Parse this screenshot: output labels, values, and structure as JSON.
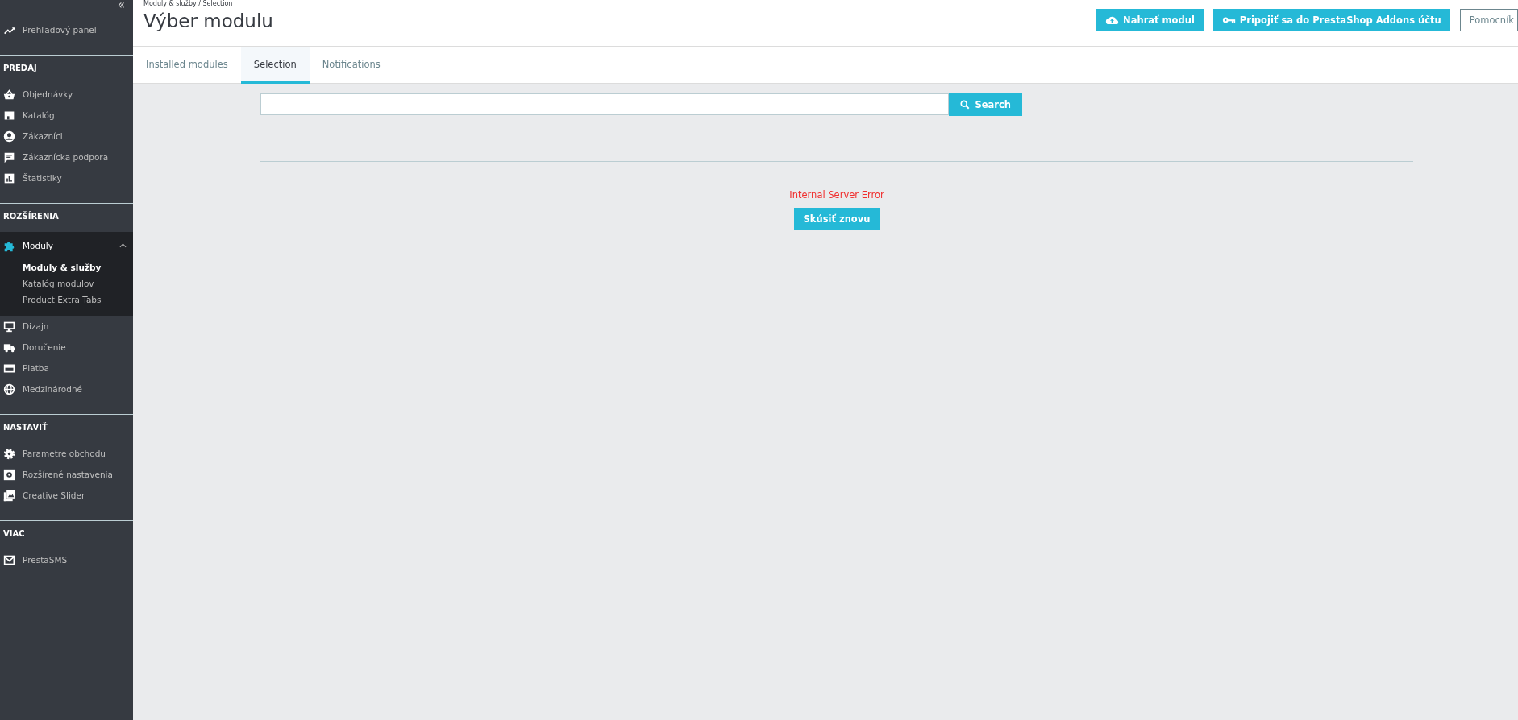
{
  "sidebar": {
    "collapse_label": "«",
    "sections": [
      {
        "items": [
          {
            "label": "Prehľadový panel",
            "selected": false,
            "expanded": false
          }
        ]
      },
      {
        "title": "PREDAJ",
        "items": [
          {
            "label": "Objednávky",
            "selected": false,
            "expanded": false
          },
          {
            "label": "Katalóg",
            "selected": false,
            "expanded": false
          },
          {
            "label": "Zákazníci",
            "selected": false,
            "expanded": false
          },
          {
            "label": "Zákaznícka podpora",
            "selected": false,
            "expanded": false
          },
          {
            "label": "Štatistiky",
            "selected": false,
            "expanded": false
          }
        ]
      },
      {
        "title": "ROZŠÍRENIA",
        "items": [
          {
            "label": "Moduly",
            "selected": true,
            "expanded": true,
            "children": [
              {
                "label": "Moduly & služby",
                "selected": true
              },
              {
                "label": "Katalóg modulov",
                "selected": false
              },
              {
                "label": "Product Extra Tabs",
                "selected": false
              }
            ]
          },
          {
            "label": "Dizajn",
            "selected": false,
            "expanded": false
          },
          {
            "label": "Doručenie",
            "selected": false,
            "expanded": false
          },
          {
            "label": "Platba",
            "selected": false,
            "expanded": false
          },
          {
            "label": "Medzinárodné",
            "selected": false,
            "expanded": false
          }
        ]
      },
      {
        "title": "NASTAVIŤ",
        "items": [
          {
            "label": "Parametre obchodu",
            "selected": false,
            "expanded": false
          },
          {
            "label": "Rozšírené nastavenia",
            "selected": false,
            "expanded": false
          },
          {
            "label": "Creative Slider",
            "selected": false,
            "expanded": false
          }
        ]
      },
      {
        "title": "VIAC",
        "items": [
          {
            "label": "PrestaSMS",
            "selected": false,
            "expanded": false
          }
        ]
      }
    ]
  },
  "header": {
    "breadcrumb": "Moduly & služby / Selection",
    "title": "Výber modulu",
    "buttons": [
      {
        "label": "Nahrať modul",
        "kind": "primary"
      },
      {
        "label": "Pripojiť sa do PrestaShop Addons účtu",
        "kind": "primary"
      },
      {
        "label": "Pomocník",
        "kind": "outline"
      }
    ]
  },
  "tabs": [
    {
      "label": "Installed modules",
      "selected": false
    },
    {
      "label": "Selection",
      "selected": true
    },
    {
      "label": "Notifications",
      "selected": false
    }
  ],
  "search": {
    "button": "Search"
  },
  "error": {
    "message": "Internal Server Error",
    "retry": "Skúsiť znovu"
  }
}
